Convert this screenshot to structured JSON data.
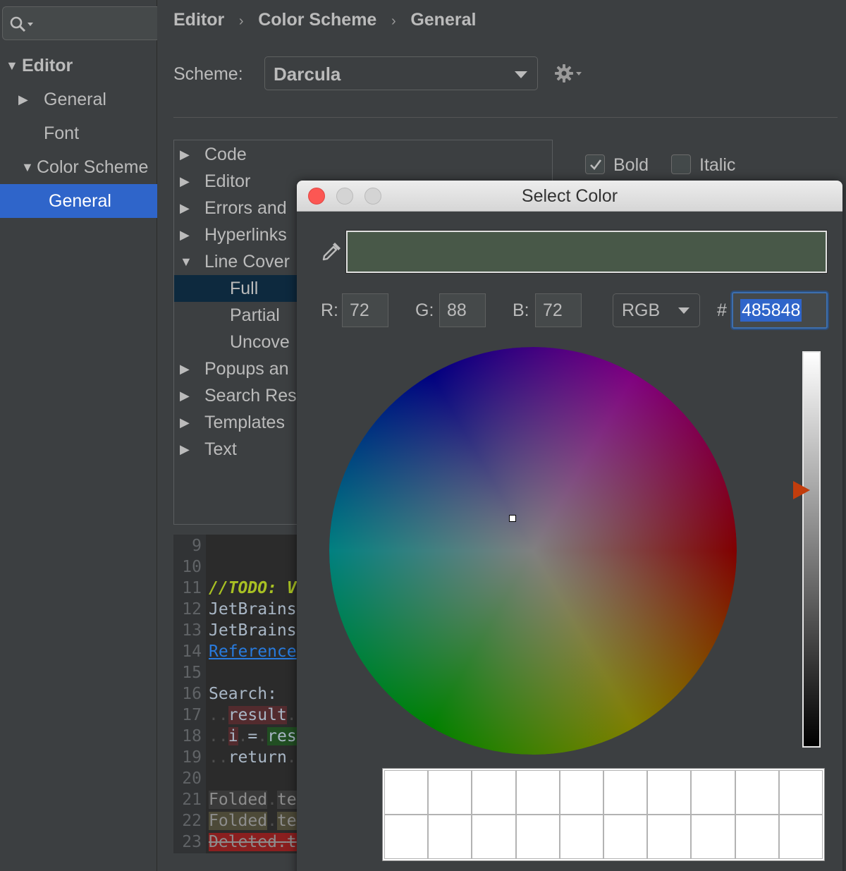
{
  "sidebar": {
    "items": [
      {
        "label": "Editor",
        "arrow": "▼"
      },
      {
        "label": "General",
        "arrow": "▶"
      },
      {
        "label": "Font",
        "arrow": ""
      },
      {
        "label": "Color Scheme",
        "arrow": "▼"
      },
      {
        "label": "General",
        "arrow": ""
      }
    ],
    "selected_index": 4
  },
  "header": {
    "breadcrumb": [
      "Editor",
      "Color Scheme",
      "General"
    ],
    "separator": "›",
    "scheme_label": "Scheme:",
    "scheme_value": "Darcula",
    "gear_icon": "gear-icon"
  },
  "tree": {
    "rows": [
      {
        "label": "Code",
        "arrow": "▶",
        "indent": 0
      },
      {
        "label": "Editor",
        "arrow": "▶",
        "indent": 0
      },
      {
        "label": "Errors and",
        "arrow": "▶",
        "indent": 0
      },
      {
        "label": "Hyperlinks",
        "arrow": "▶",
        "indent": 0
      },
      {
        "label": "Line Cover",
        "arrow": "▼",
        "indent": 0
      },
      {
        "label": "Full",
        "arrow": "",
        "indent": 1
      },
      {
        "label": "Partial",
        "arrow": "",
        "indent": 1
      },
      {
        "label": "Uncove",
        "arrow": "",
        "indent": 1
      },
      {
        "label": "Popups an",
        "arrow": "▶",
        "indent": 0
      },
      {
        "label": "Search Res",
        "arrow": "▶",
        "indent": 0
      },
      {
        "label": "Templates",
        "arrow": "▶",
        "indent": 0
      },
      {
        "label": "Text",
        "arrow": "▶",
        "indent": 0
      }
    ],
    "selected_index": 5
  },
  "options": {
    "bold_label": "Bold",
    "bold_checked": true,
    "italic_label": "Italic",
    "italic_checked": false
  },
  "preview": {
    "lines": [
      {
        "num": "9",
        "segments": []
      },
      {
        "num": "10",
        "segments": []
      },
      {
        "num": "11",
        "segments": [
          {
            "text": "//TODO: V",
            "style": "todo"
          }
        ]
      },
      {
        "num": "12",
        "segments": [
          {
            "text": "JetBrains",
            "style": ""
          }
        ]
      },
      {
        "num": "13",
        "segments": [
          {
            "text": "JetBrains",
            "style": ""
          }
        ]
      },
      {
        "num": "14",
        "segments": [
          {
            "text": "Reference",
            "style": "link"
          }
        ]
      },
      {
        "num": "15",
        "segments": []
      },
      {
        "num": "16",
        "segments": [
          {
            "text": "Search:",
            "style": ""
          }
        ]
      },
      {
        "num": "17",
        "segments": [
          {
            "text": "..",
            "style": "ws"
          },
          {
            "text": "result",
            "style": "result"
          },
          {
            "text": ".",
            "style": "ws"
          }
        ]
      },
      {
        "num": "18",
        "segments": [
          {
            "text": "..",
            "style": "ws"
          },
          {
            "text": "i",
            "style": "result"
          },
          {
            "text": ".",
            "style": "ws"
          },
          {
            "text": "=",
            "style": ""
          },
          {
            "text": ".",
            "style": "ws"
          },
          {
            "text": "res",
            "style": "res"
          }
        ]
      },
      {
        "num": "19",
        "segments": [
          {
            "text": "..",
            "style": "ws"
          },
          {
            "text": "return",
            "style": ""
          },
          {
            "text": ".",
            "style": "ws"
          }
        ]
      },
      {
        "num": "20",
        "segments": []
      },
      {
        "num": "21",
        "segments": [
          {
            "text": "Folded",
            "style": "folded1"
          },
          {
            "text": ".",
            "style": "ws"
          },
          {
            "text": "te",
            "style": "folded1"
          }
        ]
      },
      {
        "num": "22",
        "segments": [
          {
            "text": "Folded",
            "style": "folded2"
          },
          {
            "text": ".",
            "style": "ws"
          },
          {
            "text": "te",
            "style": "folded2"
          }
        ]
      },
      {
        "num": "23",
        "segments": [
          {
            "text": "Deleted",
            "style": "deleted"
          },
          {
            "text": ".",
            "style": "deleted"
          },
          {
            "text": "t",
            "style": "deleted"
          }
        ]
      }
    ]
  },
  "dialog": {
    "title": "Select Color",
    "swatch_color": "#485848",
    "r_label": "R:",
    "r_value": "72",
    "g_label": "G:",
    "g_value": "88",
    "b_label": "B:",
    "b_value": "72",
    "mode_value": "RGB",
    "hash_label": "#",
    "hex_value": "485848",
    "brightness_level": 0.65,
    "recent_colors": [
      "#ffffff",
      "#ffffff",
      "#ffffff",
      "#ffffff",
      "#ffffff",
      "#ffffff",
      "#ffffff",
      "#ffffff",
      "#ffffff",
      "#ffffff",
      "#ffffff",
      "#ffffff",
      "#ffffff",
      "#ffffff",
      "#ffffff",
      "#ffffff",
      "#ffffff",
      "#ffffff",
      "#ffffff",
      "#ffffff"
    ]
  },
  "colors": {
    "accent": "#2f65ca",
    "tree_selection": "#0d293e",
    "brightness_thumb": "#c23d0c",
    "close_button": "#fc5753"
  }
}
